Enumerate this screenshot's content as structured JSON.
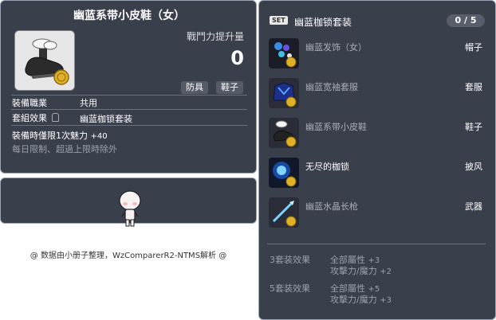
{
  "id_label": "01073326",
  "item": {
    "name": "幽蓝系带小皮鞋（女）",
    "power_label": "戰鬥力提升量",
    "power_value": "0",
    "tags": [
      "防具",
      "鞋子"
    ],
    "job_label": "裝備職業",
    "job_value": "共用",
    "set_label": "套組效果",
    "set_value": "幽蓝枷锁套装",
    "charm_line_prefix": "裝備時僅限1次魅力",
    "charm_bonus": "+40",
    "daily_limit": "每日限制、超過上限時除外"
  },
  "credit": "@ 数据由小册子整理，WzComparerR2-NTMS解析 @",
  "set": {
    "badge": "SET",
    "title": "幽蓝枷锁套装",
    "count": "0 / 5",
    "items": [
      {
        "name": "幽蓝发饰（女）",
        "slot": "帽子",
        "icon": "hair-accessory-icon"
      },
      {
        "name": "幽蓝宽袖套服",
        "slot": "套服",
        "icon": "overall-robe-icon"
      },
      {
        "name": "幽蓝系带小皮鞋",
        "slot": "鞋子",
        "icon": "shoe-icon"
      },
      {
        "name": "无尽的枷锁",
        "slot": "披风",
        "icon": "chain-cape-icon"
      },
      {
        "name": "幽蓝水晶长枪",
        "slot": "武器",
        "icon": "crystal-spear-icon"
      }
    ],
    "effects": [
      {
        "label": "3套装效果",
        "lines": [
          {
            "text": "全部屬性",
            "val": "+3"
          },
          {
            "text": "攻擊力/魔力",
            "val": "+2"
          }
        ]
      },
      {
        "label": "5套装效果",
        "lines": [
          {
            "text": "全部屬性",
            "val": "+5"
          },
          {
            "text": "攻擊力/魔力",
            "val": "+3"
          }
        ]
      }
    ]
  },
  "colors": {
    "panel_bg": "#3a3f4c",
    "border": "#9ba3b4",
    "muted": "#9aa0ad"
  }
}
